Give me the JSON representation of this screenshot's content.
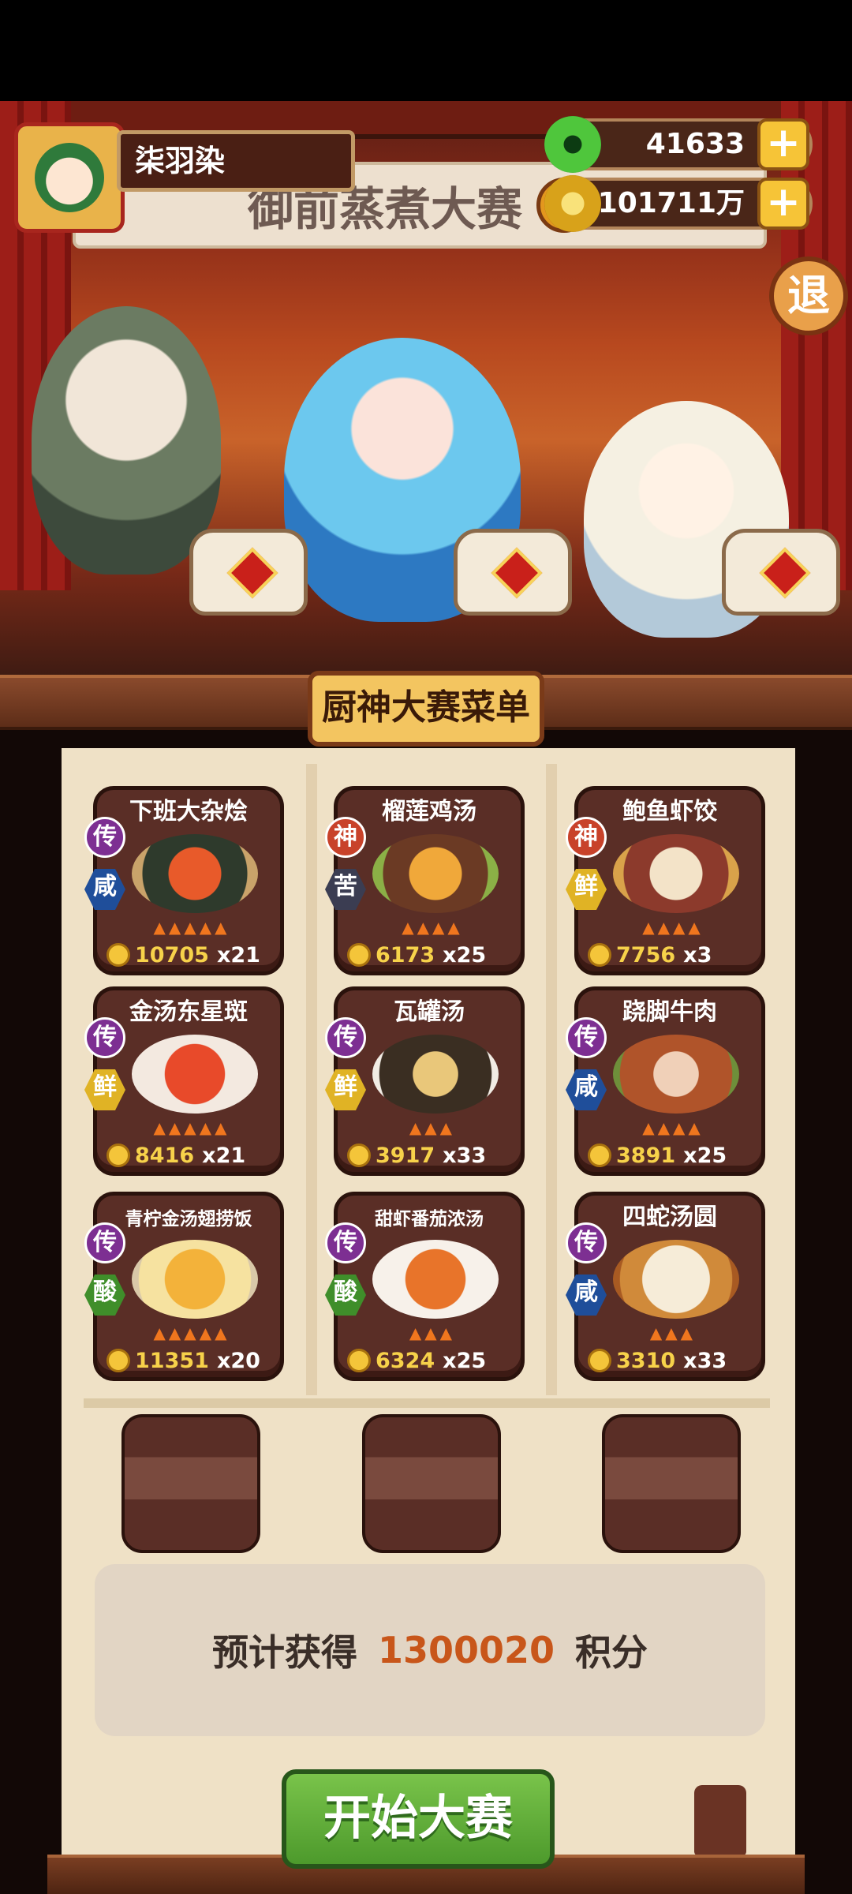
{
  "player": {
    "name": "柒羽染"
  },
  "currency": {
    "jade": "41633",
    "gold": "101711万",
    "add_label": "+"
  },
  "exit_label": "退",
  "event_banner": {
    "title": "御前蒸煮大赛",
    "alert": "!"
  },
  "menu": {
    "title": "厨神大赛菜单",
    "dishes": [
      {
        "name": "下班大杂烩",
        "rank": "传",
        "flavor": "咸",
        "price": "10705",
        "qty": "x21",
        "flames": 5
      },
      {
        "name": "榴莲鸡汤",
        "rank": "神",
        "flavor": "苦",
        "price": "6173",
        "qty": "x25",
        "flames": 4
      },
      {
        "name": "鲍鱼虾饺",
        "rank": "神",
        "flavor": "鲜",
        "price": "7756",
        "qty": "x3",
        "flames": 4
      },
      {
        "name": "金汤东星斑",
        "rank": "传",
        "flavor": "鲜",
        "price": "8416",
        "qty": "x21",
        "flames": 5
      },
      {
        "name": "瓦罐汤",
        "rank": "传",
        "flavor": "鲜",
        "price": "3917",
        "qty": "x33",
        "flames": 3
      },
      {
        "name": "跷脚牛肉",
        "rank": "传",
        "flavor": "咸",
        "price": "3891",
        "qty": "x25",
        "flames": 4
      },
      {
        "name": "青柠金汤翅捞饭",
        "rank": "传",
        "flavor": "酸",
        "price": "11351",
        "qty": "x20",
        "flames": 5
      },
      {
        "name": "甜虾番茄浓汤",
        "rank": "传",
        "flavor": "酸",
        "price": "6324",
        "qty": "x25",
        "flames": 3
      },
      {
        "name": "四蛇汤圆",
        "rank": "传",
        "flavor": "咸",
        "price": "3310",
        "qty": "x33",
        "flames": 3
      }
    ]
  },
  "estimate": {
    "prefix": "预计获得",
    "value": "1300020",
    "suffix": "积分"
  },
  "start_button": "开始大赛"
}
